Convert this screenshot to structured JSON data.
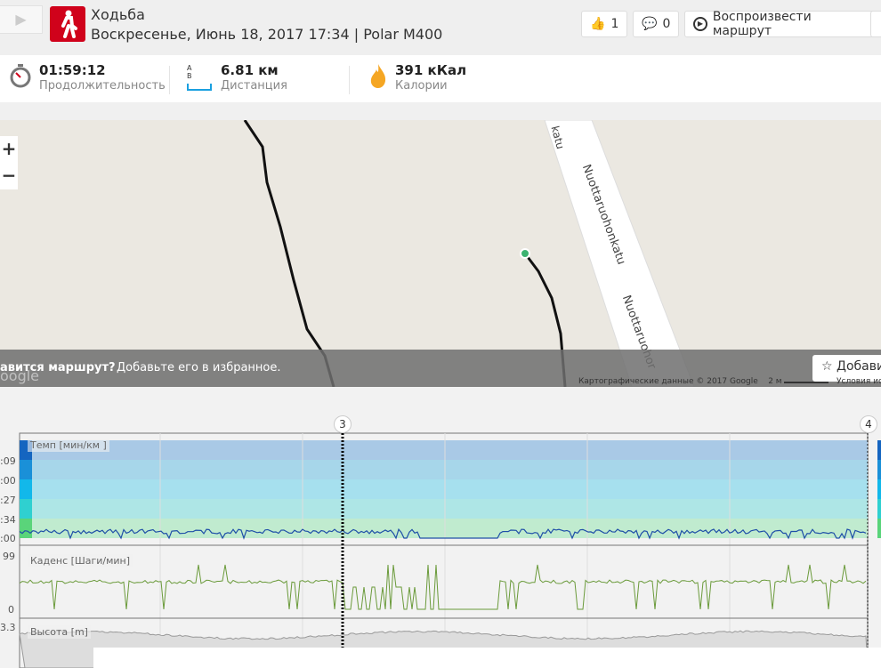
{
  "header": {
    "title": "Ходьба",
    "subtitle": "Воскресенье, Июнь 18, 2017 17:34 | Polar M400",
    "likes": "1",
    "comments": "0",
    "replay_label": "Воспроизвести маршрут"
  },
  "stats": [
    {
      "value": "01:59:12",
      "label": "Продолжительность"
    },
    {
      "value": "6.81 км",
      "label": "Дистанция",
      "icon_letters": "A B"
    },
    {
      "value": "391 кКал",
      "label": "Калории"
    }
  ],
  "map": {
    "street1": "Nuottaruohonkatu",
    "street2": "Nuottaruohonkatu",
    "street_top": "katu",
    "street3": "Nuottaruohor",
    "overlay_q": "авится маршрут?",
    "overlay_text": "Добавьте его в избранное.",
    "fav_label": "Добавить",
    "attribution": "Картографические данные © 2017 Google",
    "scale": "2 м",
    "terms": "Условия ис",
    "google": "oogle"
  },
  "charts": {
    "markers": [
      "3",
      "4"
    ],
    "pace": {
      "label": "Темп [мин/км ]",
      "ticks": [
        ":09",
        ":00",
        ":27",
        ":34",
        ":00"
      ]
    },
    "cadence": {
      "label": "Каденс [Шаги/мин]",
      "max": "99",
      "min": "0"
    },
    "altitude": {
      "label": "Высота [m]",
      "max": "3.3"
    }
  }
}
